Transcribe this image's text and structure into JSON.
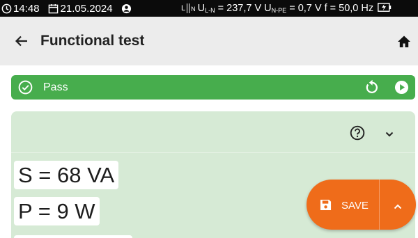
{
  "statusbar": {
    "time": "14:48",
    "date": "21.05.2024",
    "plug_l": "L",
    "plug_n": "N",
    "u_ln_prefix": "U",
    "u_ln_sub": "L-N",
    "u_ln_value": " = 237,7 V ",
    "u_npe_prefix": "U",
    "u_npe_sub": "N-PE",
    "u_npe_value": " = 0,7 V ",
    "freq": "f = 50,0 Hz"
  },
  "appbar": {
    "title": "Functional test"
  },
  "result": {
    "label": "Pass",
    "color": "#47ad4d"
  },
  "measurements": {
    "s": "S = 68 VA",
    "p": "P = 9 W"
  },
  "fab": {
    "save_label": "SAVE",
    "color": "#ef6c1a"
  },
  "icons": {
    "clock": "clock-icon",
    "calendar": "calendar-icon",
    "user": "user-icon",
    "battery": "battery-charging-icon",
    "back": "arrow-back-icon",
    "home": "home-icon",
    "check": "check-circle-icon",
    "retry": "redo-icon",
    "play": "play-circle-icon",
    "help": "help-circle-icon",
    "expand": "chevron-down-icon",
    "save": "floppy-icon",
    "more": "chevron-up-icon"
  }
}
